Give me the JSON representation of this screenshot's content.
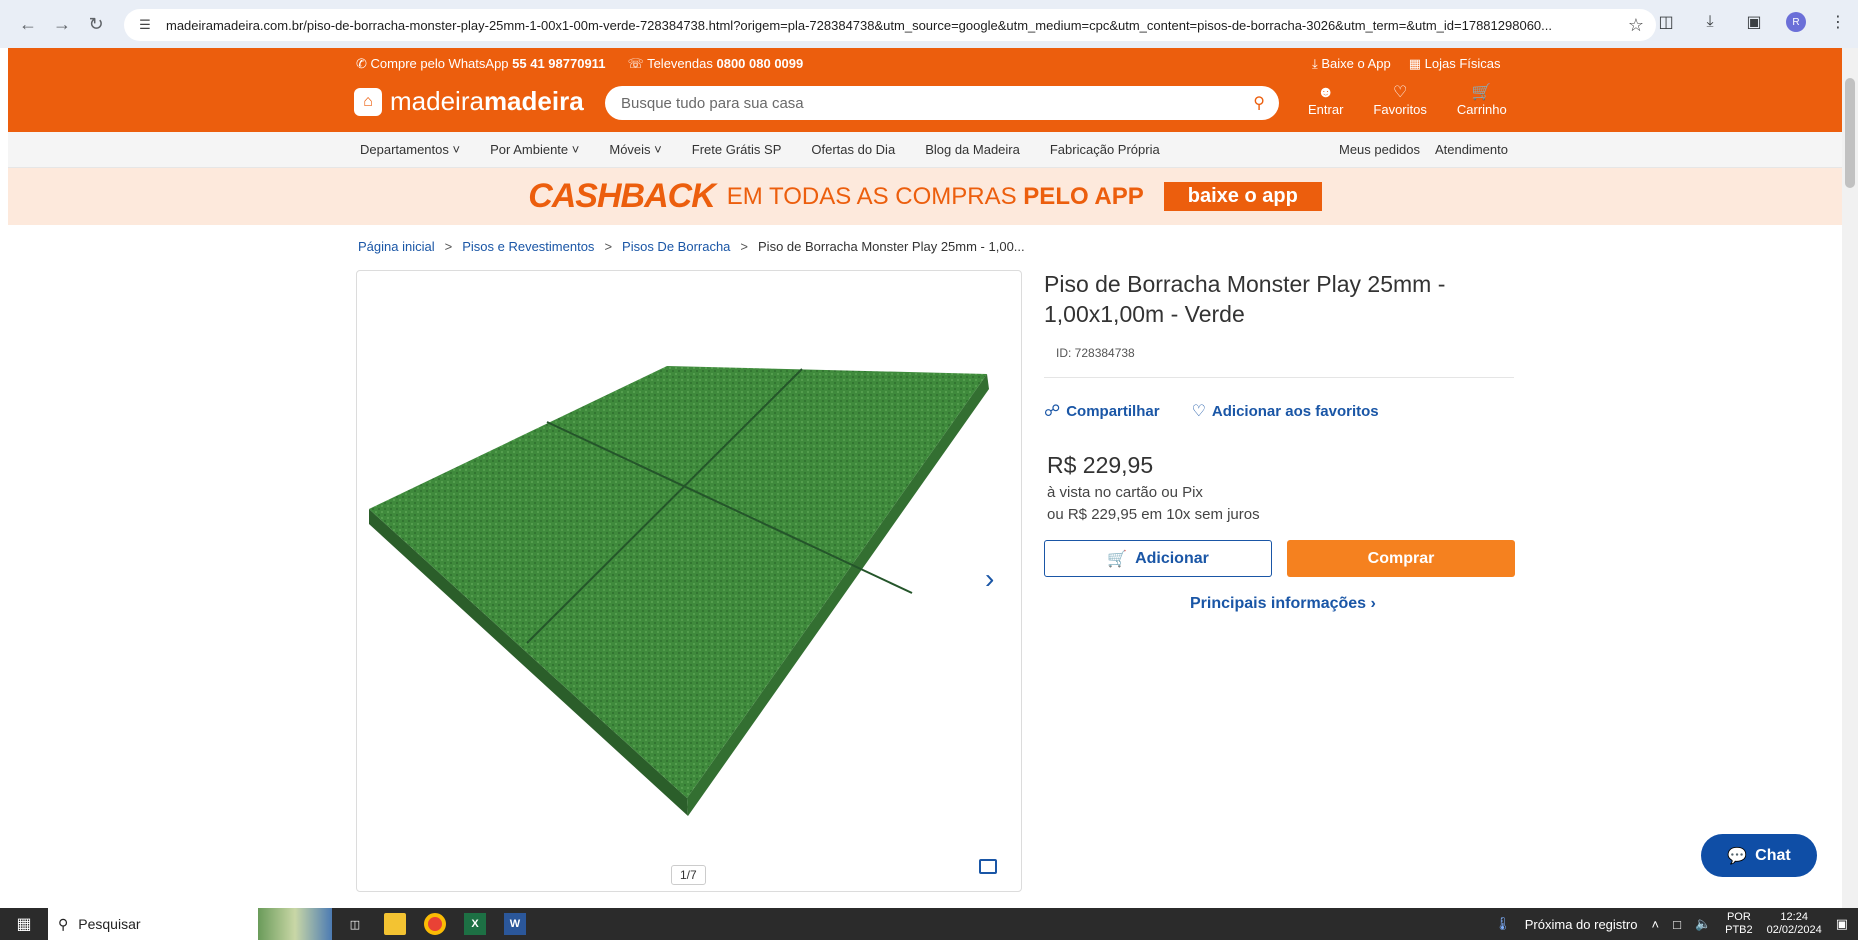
{
  "browser": {
    "url": "madeiramadeira.com.br/piso-de-borracha-monster-play-25mm-1-00x1-00m-verde-728384738.html?origem=pla-728384738&utm_source=google&utm_medium=cpc&utm_content=pisos-de-borracha-3026&utm_term=&utm_id=17881298060...",
    "profile_initial": "R"
  },
  "header": {
    "whatsapp_text": "Compre pelo WhatsApp",
    "whatsapp_number": "55 41 98770911",
    "televendas_text": "Televendas",
    "televendas_number": "0800 080 0099",
    "baixe_app": "Baixe o App",
    "lojas_fisicas": "Lojas Físicas",
    "logo_light": "madeira",
    "logo_bold": "madeira",
    "search_placeholder": "Busque tudo para sua casa",
    "entrar": "Entrar",
    "favoritos": "Favoritos",
    "carrinho": "Carrinho"
  },
  "nav": {
    "items": [
      "Departamentos",
      "Por Ambiente",
      "Móveis",
      "Frete Grátis SP",
      "Ofertas do Dia",
      "Blog da Madeira",
      "Fabricação Própria"
    ],
    "meus_pedidos": "Meus pedidos",
    "atendimento": "Atendimento"
  },
  "banner": {
    "cashback": "CASHBACK",
    "rest_plain": "EM TODAS AS COMPRAS",
    "rest_bold": "PELO APP",
    "button": "baixe o app"
  },
  "breadcrumb": {
    "home": "Página inicial",
    "cat1": "Pisos e Revestimentos",
    "cat2": "Pisos De Borracha",
    "current": "Piso de Borracha Monster Play 25mm - 1,00..."
  },
  "gallery": {
    "counter": "1/7"
  },
  "product": {
    "title": "Piso de Borracha Monster Play 25mm - 1,00x1,00m - Verde",
    "id": "ID: 728384738",
    "share": "Compartilhar",
    "favorite": "Adicionar aos favoritos",
    "price": "R$ 229,95",
    "price_note": "à vista no cartão ou Pix",
    "installments": "ou R$ 229,95 em 10x sem juros",
    "add_button": "Adicionar",
    "buy_button": "Comprar",
    "more_info": "Principais informações"
  },
  "chat": {
    "label": "Chat"
  },
  "taskbar": {
    "search": "Pesquisar",
    "notification": "Próxima do registro",
    "lang1": "POR",
    "lang2": "PTB2",
    "time": "12:24",
    "date": "02/02/2024"
  },
  "colors": {
    "brand_orange": "#ec5e0d",
    "link_blue": "#1a56a6",
    "buy_orange": "#f5811f",
    "chat_blue": "#0f4ea6"
  }
}
